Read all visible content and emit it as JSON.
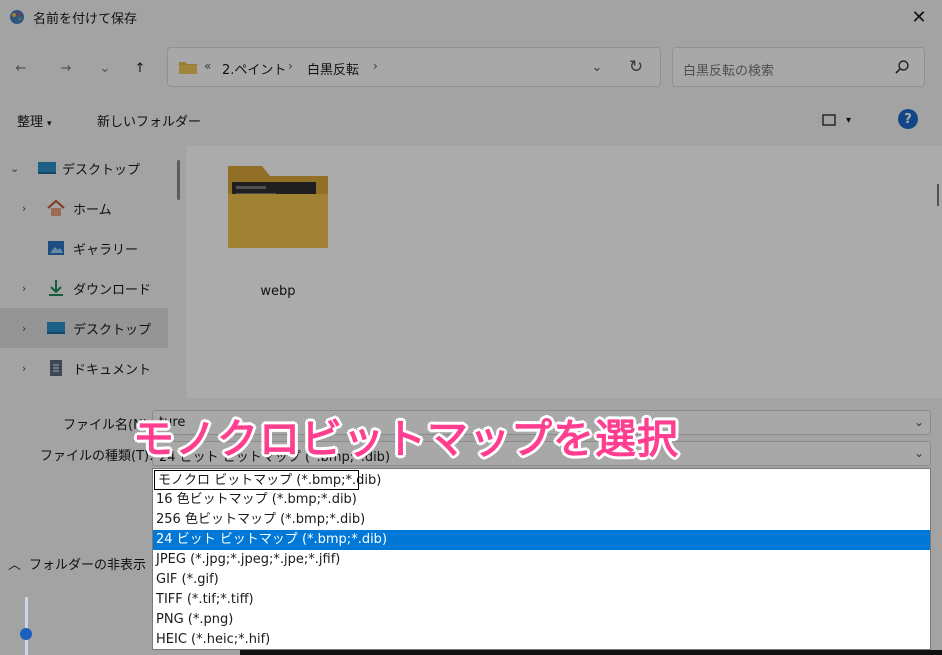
{
  "window": {
    "title": "名前を付けて保存",
    "close_glyph": "✕"
  },
  "nav": {
    "back_glyph": "←",
    "forward_glyph": "→",
    "recent_glyph": "⌄",
    "up_glyph": "↑",
    "address": {
      "overflow": "«",
      "crumbs": [
        "2.ペイント",
        "白黒反転"
      ],
      "separator": "›",
      "dropdown_glyph": "⌄",
      "refresh_glyph": "↻"
    },
    "search": {
      "placeholder": "白黒反転の検索"
    }
  },
  "commandbar": {
    "organize": "整理",
    "organize_caret": "▾",
    "new_folder": "新しいフォルダー",
    "view_caret": "▾",
    "help": "?"
  },
  "sidebar": {
    "items": [
      {
        "label": "デスクトップ",
        "arrow": "⌄",
        "icon": "desktop-icon"
      },
      {
        "label": "ホーム",
        "arrow": "›",
        "icon": "home-icon"
      },
      {
        "label": "ギャラリー",
        "arrow": "",
        "icon": "gallery-icon"
      },
      {
        "label": "ダウンロード",
        "arrow": "›",
        "icon": "download-icon"
      },
      {
        "label": "デスクトップ",
        "arrow": "›",
        "icon": "desktop-icon"
      },
      {
        "label": "ドキュメント",
        "arrow": "›",
        "icon": "document-icon"
      }
    ]
  },
  "files": [
    {
      "name": "webp",
      "type": "folder"
    }
  ],
  "form": {
    "filename_label": "ファイル名(N):",
    "filename_value": "ture",
    "filetype_label": "ファイルの種類(T):",
    "filetype_value": "24 ビット ビットマップ (*.bmp;*.dib)",
    "dropdown_glyph": "⌄",
    "hide_folders_glyph": "︿",
    "hide_folders": "フォルダーの非表示"
  },
  "filetype_options": [
    "モノクロ ビットマップ (*.bmp;*.dib)",
    "16 色ビットマップ (*.bmp;*.dib)",
    "256 色ビットマップ (*.bmp;*.dib)",
    "24 ビット ビットマップ (*.bmp;*.dib)",
    "JPEG (*.jpg;*.jpeg;*.jpe;*.jfif)",
    "GIF (*.gif)",
    "TIFF (*.tif;*.tiff)",
    "PNG (*.png)",
    "HEIC (*.heic;*.hif)"
  ],
  "annotation": {
    "text": "モノクロビットマップを選択",
    "color": "#ff3e8f"
  },
  "colors": {
    "accent": "#0078d7",
    "help": "#1b6ac9"
  }
}
